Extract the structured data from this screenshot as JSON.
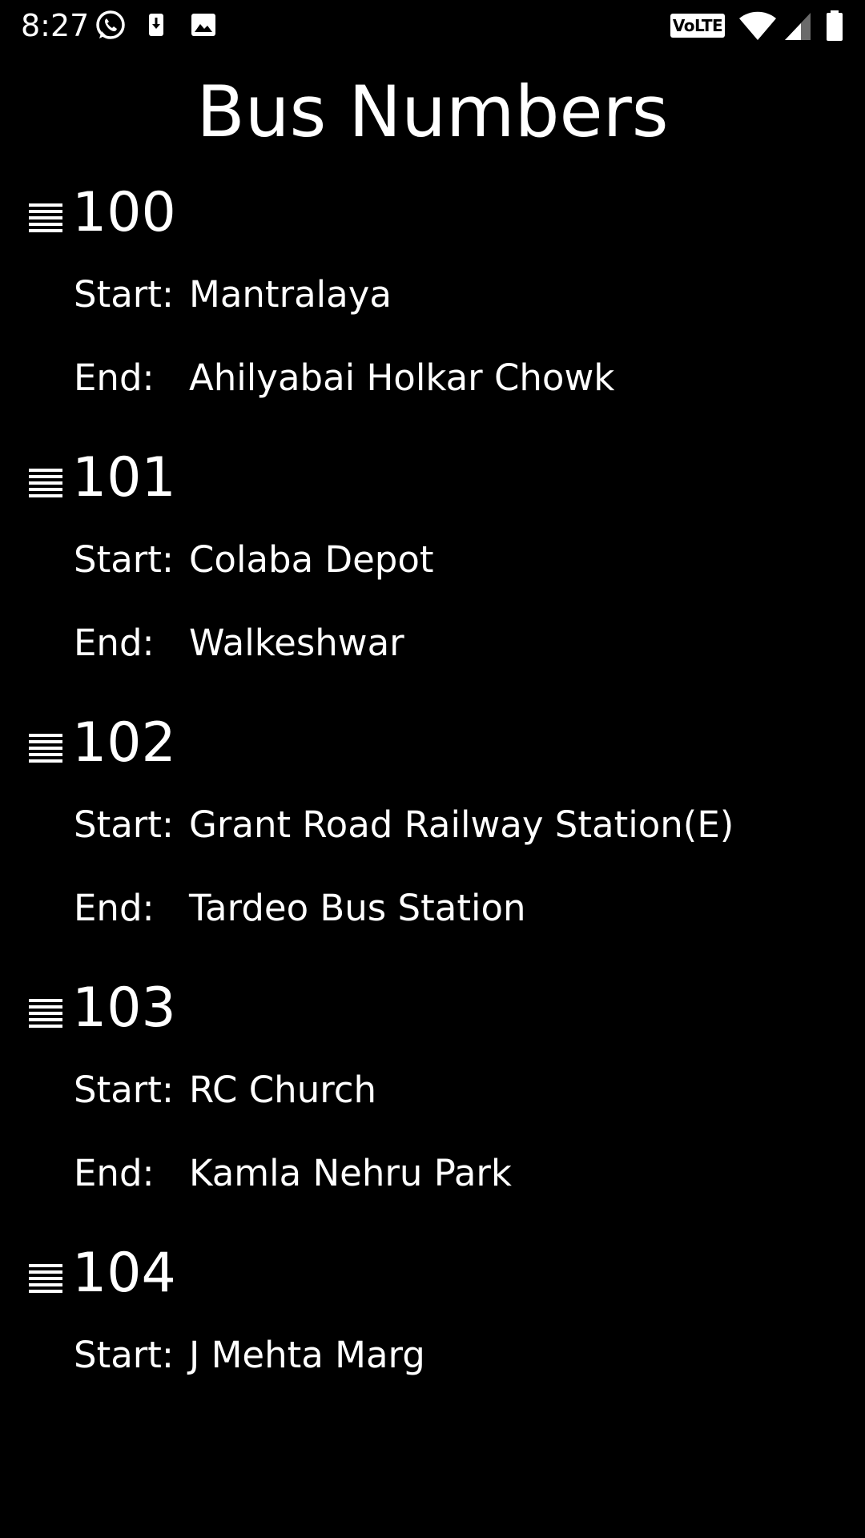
{
  "status_bar": {
    "time": "8:27",
    "volte": "VoLTE",
    "icons": [
      "whatsapp-icon",
      "download-icon",
      "image-icon",
      "volte-icon",
      "wifi-icon",
      "signal-icon",
      "battery-icon"
    ]
  },
  "page": {
    "title": "Bus Numbers"
  },
  "buses": [
    {
      "number": "100",
      "start_label": "Start:",
      "start": "Mantralaya",
      "end_label": "End:",
      "end": "Ahilyabai Holkar Chowk"
    },
    {
      "number": "101",
      "start_label": "Start:",
      "start": "Colaba Depot",
      "end_label": "End:",
      "end": "Walkeshwar"
    },
    {
      "number": "102",
      "start_label": "Start:",
      "start": "Grant Road Railway Station(E)",
      "end_label": "End:",
      "end": "Tardeo Bus Station"
    },
    {
      "number": "103",
      "start_label": "Start:",
      "start": "RC Church",
      "end_label": "End:",
      "end": "Kamla Nehru Park"
    },
    {
      "number": "104",
      "start_label": "Start:",
      "start": "J Mehta Marg"
    }
  ],
  "colors": {
    "background": "#000000",
    "text": "#ffffff"
  }
}
